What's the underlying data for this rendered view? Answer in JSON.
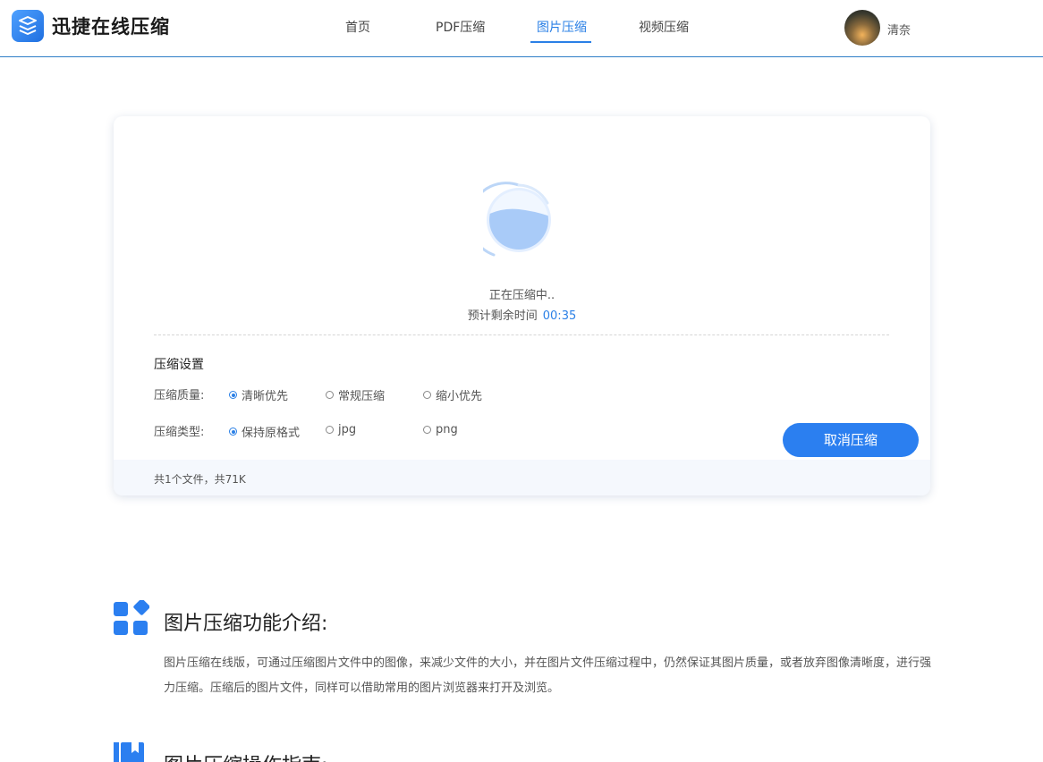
{
  "header": {
    "app_title": "迅捷在线压缩",
    "nav": [
      {
        "label": "首页"
      },
      {
        "label": "PDF压缩"
      },
      {
        "label": "图片压缩"
      },
      {
        "label": "视频压缩"
      }
    ],
    "active_nav": "图片压缩",
    "user_name": "清奈"
  },
  "progress": {
    "status": "正在压缩中..",
    "remaining_label": "预计剩余时间",
    "remaining_value": "00:35"
  },
  "settings": {
    "title": "压缩设置",
    "quality": {
      "label": "压缩质量:",
      "options": [
        "清晰优先",
        "常规压缩",
        "缩小优先"
      ],
      "selected": "清晰优先"
    },
    "type": {
      "label": "压缩类型:",
      "options": [
        "保持原格式",
        "jpg",
        "png"
      ],
      "selected": "保持原格式"
    },
    "cancel_label": "取消压缩"
  },
  "footer": {
    "summary": "共1个文件，共71K"
  },
  "intro": {
    "title": "图片压缩功能介绍:",
    "body": "图片压缩在线版，可通过压缩图片文件中的图像，来减少文件的大小，并在图片文件压缩过程中，仍然保证其图片质量，或者放弃图像清晰度，进行强力压缩。压缩后的图片文件，同样可以借助常用的图片浏览器来打开及浏览。"
  },
  "guide": {
    "title": "图片压缩操作指南:"
  },
  "colors": {
    "accent": "#2b80e6",
    "button": "#2b7ff0",
    "header_border": "#2f7fc7"
  },
  "icons": {
    "logo": "stacked-layers-icon",
    "section1": "app-grid-icon",
    "section2": "book-icon",
    "spinner": "loading-circle-icon"
  }
}
